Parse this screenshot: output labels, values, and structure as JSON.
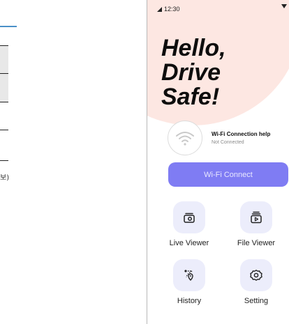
{
  "left_fragment": {
    "char": "보)"
  },
  "status_bar": {
    "time": "12:30",
    "signal_icon": "signal-icon",
    "right_icon": "wifi-down-icon"
  },
  "hero": {
    "line1": "Hello,",
    "line2": "Drive",
    "line3": "Safe!"
  },
  "wifi": {
    "title": "Wi-Fi Connection help",
    "status": "Not Connected",
    "icon": "wifi-icon"
  },
  "connect_button": {
    "label": "Wi-Fi Connect"
  },
  "features": [
    {
      "label": "Live Viewer",
      "icon": "live-camera-icon"
    },
    {
      "label": "File Viewer",
      "icon": "file-video-icon"
    },
    {
      "label": "History",
      "icon": "location-history-icon"
    },
    {
      "label": "Setting",
      "icon": "gear-icon"
    }
  ],
  "colors": {
    "accent": "#7f7cf3",
    "tile": "#ecedfb",
    "blob": "#fde7e2"
  }
}
